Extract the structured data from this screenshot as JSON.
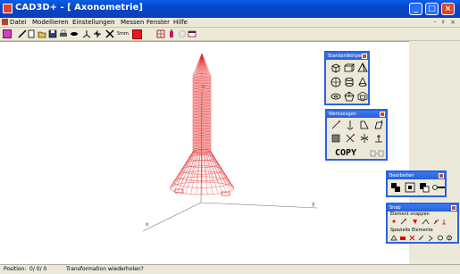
{
  "window": {
    "title": "CAD3D+ - [ Axonometrie]"
  },
  "menu": {
    "items": [
      "Datei",
      "Modellieren",
      "Einstellungen",
      "Messen",
      "Fenster",
      "Hilfe"
    ],
    "mdi_controls": "- ♯ ×"
  },
  "toolbar": {
    "icons": [
      "select-icon",
      "line-icon",
      "new-icon",
      "open-icon",
      "save-icon",
      "print-icon",
      "view-icon",
      "axes-icon",
      "move-icon",
      "measure-icon",
      "frame-icon",
      "grid-icon",
      "info-icon",
      "circle-icon",
      "window-icon"
    ],
    "color_swatch": "#E8191E"
  },
  "viewport": {
    "axis_labels": {
      "x": "x",
      "y": "y",
      "z": "z"
    },
    "model_color": "#E41C1C"
  },
  "palettes": {
    "standard": {
      "title": "Standardkörper"
    },
    "tools": {
      "title": "Werkzeugen",
      "copy_label": "COPY"
    },
    "edit": {
      "title": "Bearbeiten"
    },
    "snap": {
      "title": "Snap",
      "group1": "Element snappen",
      "group2": "Spezielle Elemente"
    }
  },
  "statusbar": {
    "position_label": "Position:",
    "position_value": "0/ 0/ 0",
    "message": "Transformation wiederholen?"
  }
}
